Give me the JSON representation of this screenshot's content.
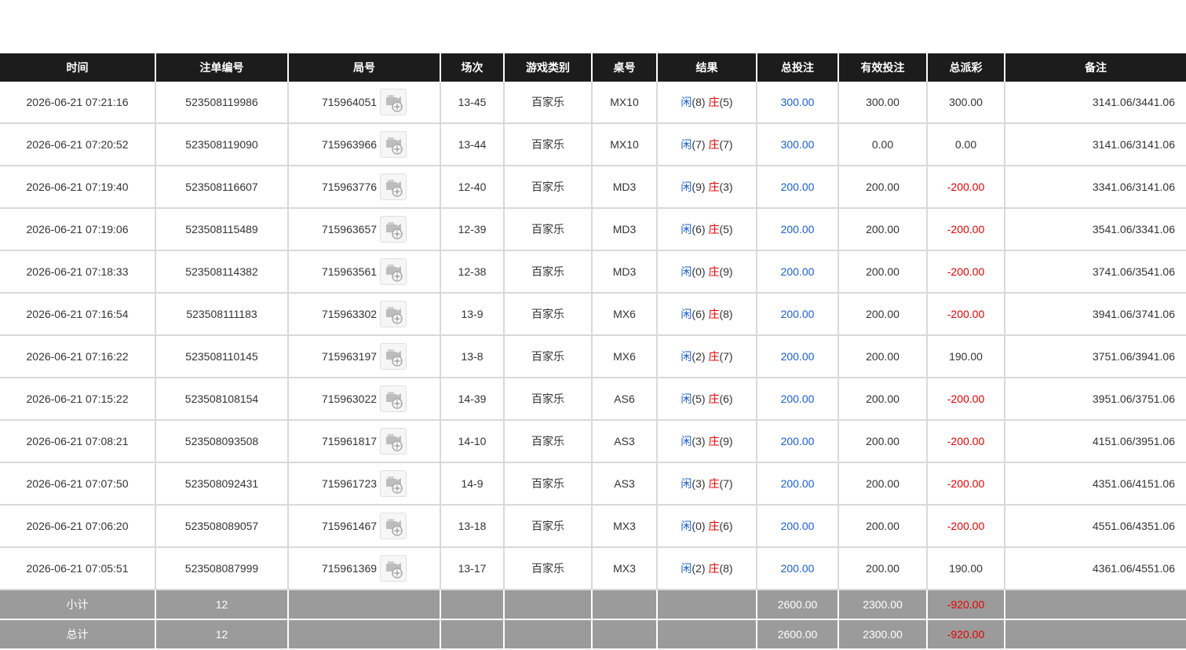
{
  "headers": [
    "时间",
    "注单编号",
    "局号",
    "场次",
    "游戏类别",
    "桌号",
    "结果",
    "总投注",
    "有效投注",
    "总派彩",
    "备注"
  ],
  "rows": [
    {
      "time": "2026-06-21 07:21:16",
      "bet_id": "523508119986",
      "round": "715964051",
      "session": "13-45",
      "game": "百家乐",
      "table": "MX10",
      "p_label": "闲",
      "p_val": "(8)",
      "b_label": "庄",
      "b_val": "(5)",
      "total_bet": "300.00",
      "valid_bet": "300.00",
      "payout": "300.00",
      "remark": "3141.06/3441.06"
    },
    {
      "time": "2026-06-21 07:20:52",
      "bet_id": "523508119090",
      "round": "715963966",
      "session": "13-44",
      "game": "百家乐",
      "table": "MX10",
      "p_label": "闲",
      "p_val": "(7)",
      "b_label": "庄",
      "b_val": "(7)",
      "total_bet": "300.00",
      "valid_bet": "0.00",
      "payout": "0.00",
      "remark": "3141.06/3141.06"
    },
    {
      "time": "2026-06-21 07:19:40",
      "bet_id": "523508116607",
      "round": "715963776",
      "session": "12-40",
      "game": "百家乐",
      "table": "MD3",
      "p_label": "闲",
      "p_val": "(9)",
      "b_label": "庄",
      "b_val": "(3)",
      "total_bet": "200.00",
      "valid_bet": "200.00",
      "payout": "-200.00",
      "remark": "3341.06/3141.06"
    },
    {
      "time": "2026-06-21 07:19:06",
      "bet_id": "523508115489",
      "round": "715963657",
      "session": "12-39",
      "game": "百家乐",
      "table": "MD3",
      "p_label": "闲",
      "p_val": "(6)",
      "b_label": "庄",
      "b_val": "(5)",
      "total_bet": "200.00",
      "valid_bet": "200.00",
      "payout": "-200.00",
      "remark": "3541.06/3341.06"
    },
    {
      "time": "2026-06-21 07:18:33",
      "bet_id": "523508114382",
      "round": "715963561",
      "session": "12-38",
      "game": "百家乐",
      "table": "MD3",
      "p_label": "闲",
      "p_val": "(0)",
      "b_label": "庄",
      "b_val": "(9)",
      "total_bet": "200.00",
      "valid_bet": "200.00",
      "payout": "-200.00",
      "remark": "3741.06/3541.06"
    },
    {
      "time": "2026-06-21 07:16:54",
      "bet_id": "523508111183",
      "round": "715963302",
      "session": "13-9",
      "game": "百家乐",
      "table": "MX6",
      "p_label": "闲",
      "p_val": "(6)",
      "b_label": "庄",
      "b_val": "(8)",
      "total_bet": "200.00",
      "valid_bet": "200.00",
      "payout": "-200.00",
      "remark": "3941.06/3741.06"
    },
    {
      "time": "2026-06-21 07:16:22",
      "bet_id": "523508110145",
      "round": "715963197",
      "session": "13-8",
      "game": "百家乐",
      "table": "MX6",
      "p_label": "闲",
      "p_val": "(2)",
      "b_label": "庄",
      "b_val": "(7)",
      "total_bet": "200.00",
      "valid_bet": "200.00",
      "payout": "190.00",
      "remark": "3751.06/3941.06"
    },
    {
      "time": "2026-06-21 07:15:22",
      "bet_id": "523508108154",
      "round": "715963022",
      "session": "14-39",
      "game": "百家乐",
      "table": "AS6",
      "p_label": "闲",
      "p_val": "(5)",
      "b_label": "庄",
      "b_val": "(6)",
      "total_bet": "200.00",
      "valid_bet": "200.00",
      "payout": "-200.00",
      "remark": "3951.06/3751.06"
    },
    {
      "time": "2026-06-21 07:08:21",
      "bet_id": "523508093508",
      "round": "715961817",
      "session": "14-10",
      "game": "百家乐",
      "table": "AS3",
      "p_label": "闲",
      "p_val": "(3)",
      "b_label": "庄",
      "b_val": "(9)",
      "total_bet": "200.00",
      "valid_bet": "200.00",
      "payout": "-200.00",
      "remark": "4151.06/3951.06"
    },
    {
      "time": "2026-06-21 07:07:50",
      "bet_id": "523508092431",
      "round": "715961723",
      "session": "14-9",
      "game": "百家乐",
      "table": "AS3",
      "p_label": "闲",
      "p_val": "(3)",
      "b_label": "庄",
      "b_val": "(7)",
      "total_bet": "200.00",
      "valid_bet": "200.00",
      "payout": "-200.00",
      "remark": "4351.06/4151.06"
    },
    {
      "time": "2026-06-21 07:06:20",
      "bet_id": "523508089057",
      "round": "715961467",
      "session": "13-18",
      "game": "百家乐",
      "table": "MX3",
      "p_label": "闲",
      "p_val": "(0)",
      "b_label": "庄",
      "b_val": "(6)",
      "total_bet": "200.00",
      "valid_bet": "200.00",
      "payout": "-200.00",
      "remark": "4551.06/4351.06"
    },
    {
      "time": "2026-06-21 07:05:51",
      "bet_id": "523508087999",
      "round": "715961369",
      "session": "13-17",
      "game": "百家乐",
      "table": "MX3",
      "p_label": "闲",
      "p_val": "(2)",
      "b_label": "庄",
      "b_val": "(8)",
      "total_bet": "200.00",
      "valid_bet": "200.00",
      "payout": "190.00",
      "remark": "4361.06/4551.06"
    }
  ],
  "subtotal": {
    "label": "小计",
    "count": "12",
    "total_bet": "2600.00",
    "valid_bet": "2300.00",
    "payout": "-920.00"
  },
  "grandtotal": {
    "label": "总计",
    "count": "12",
    "total_bet": "2600.00",
    "valid_bet": "2300.00",
    "payout": "-920.00"
  },
  "colors": {
    "header_bg": "#1c1c1c",
    "summary_bg": "#9b9b9b",
    "blue": "#1a5fd0",
    "red": "#e60000"
  },
  "icons": {
    "replay": "video-replay-icon"
  }
}
